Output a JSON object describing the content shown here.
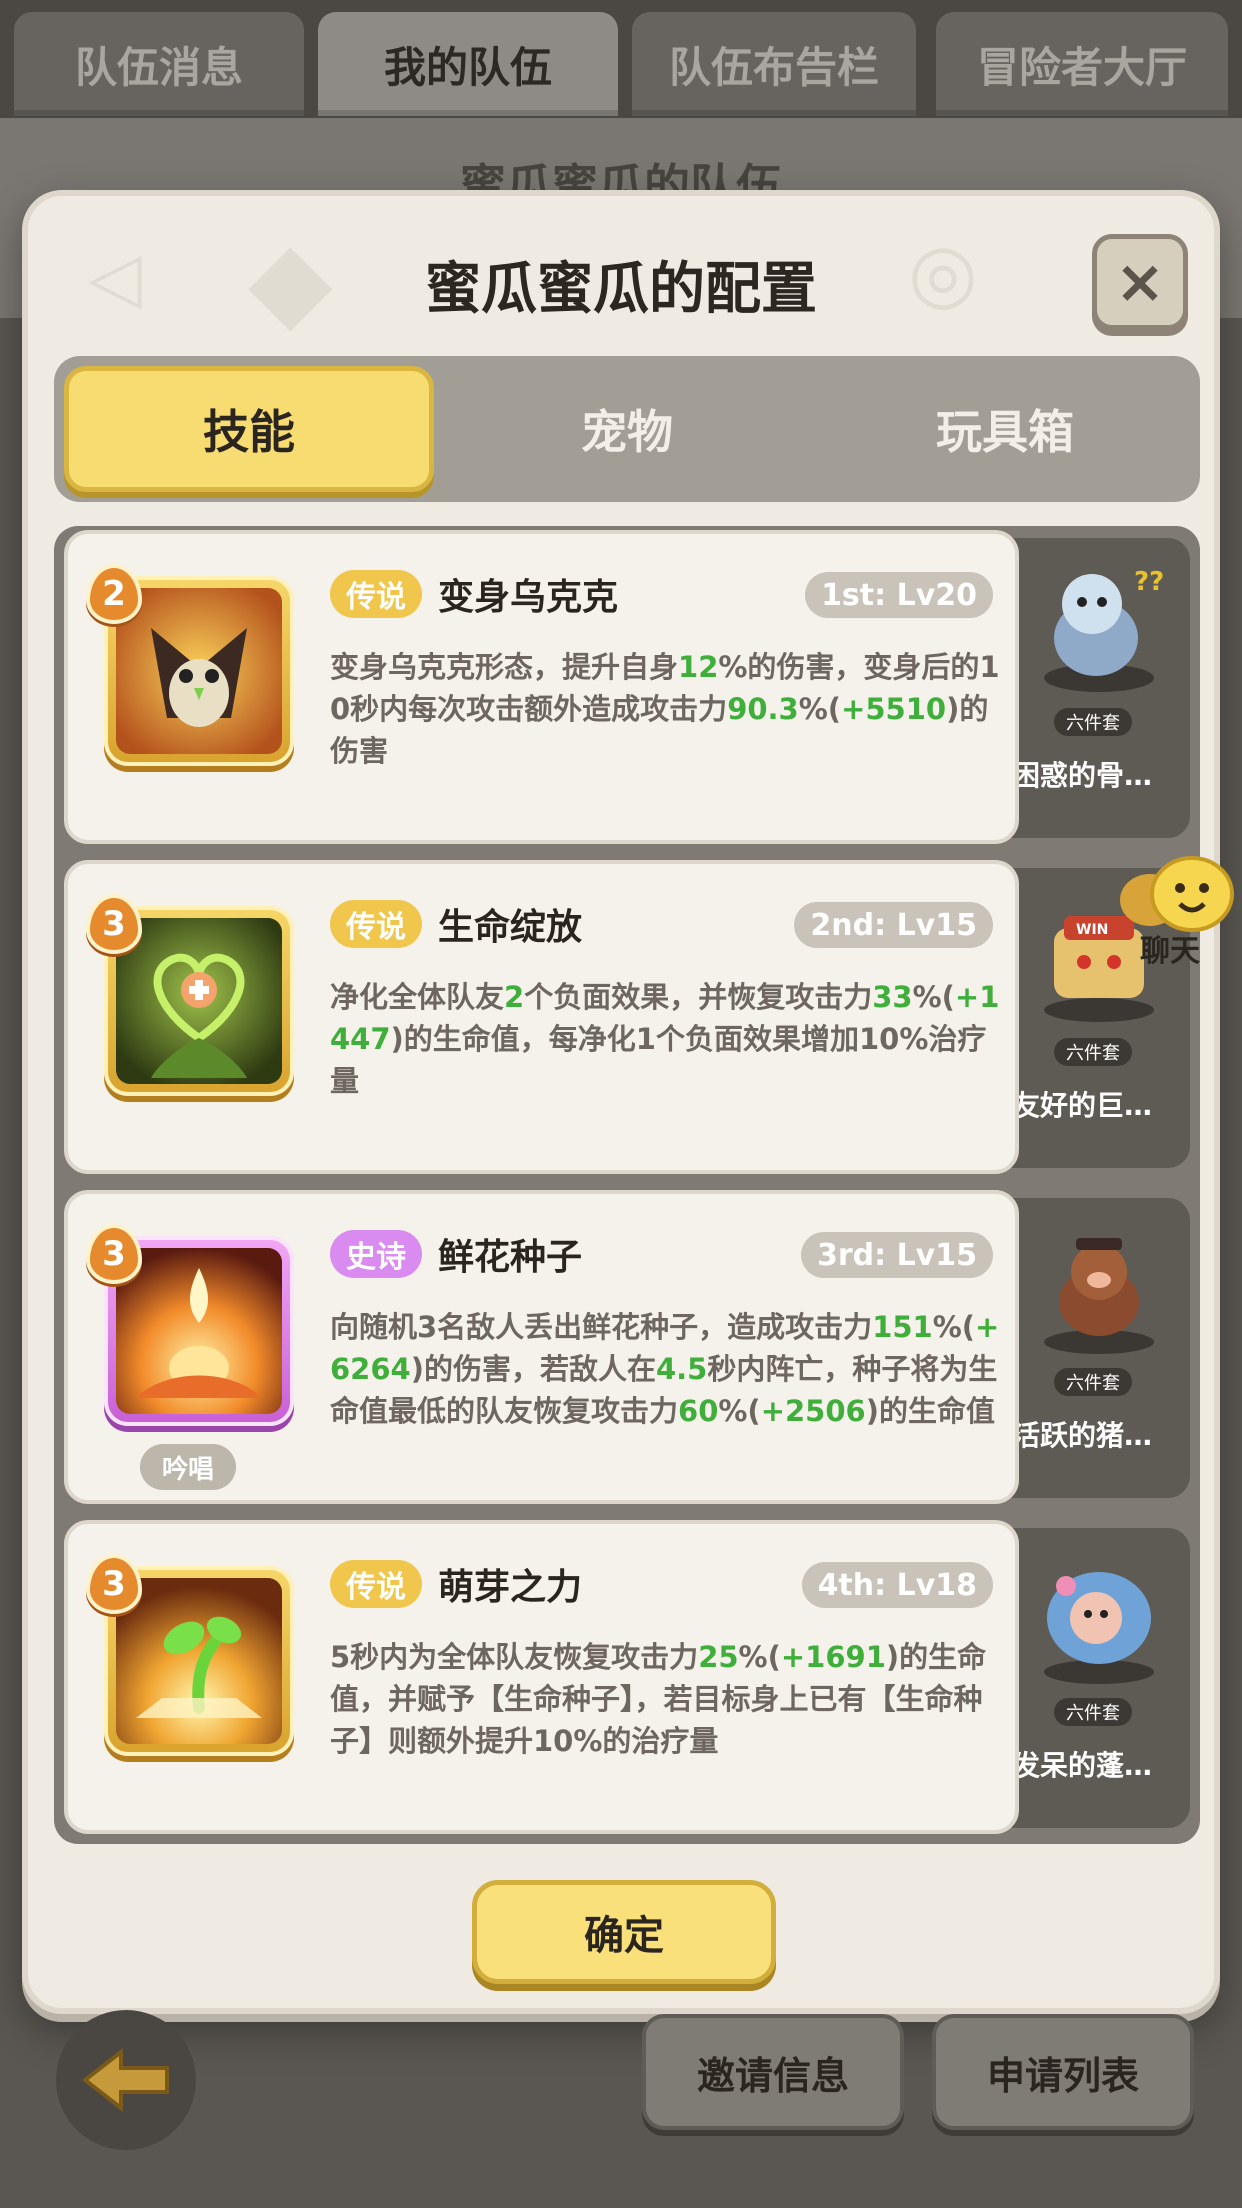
{
  "top_tabs": [
    "队伍消息",
    "我的队伍",
    "队伍布告栏",
    "冒险者大厅"
  ],
  "background_title": "蜜瓜蜜瓜的队伍",
  "modal": {
    "title": "蜜瓜蜜瓜的配置",
    "close_label": "×",
    "tabs": [
      "技能",
      "宠物",
      "玩具箱"
    ],
    "confirm_label": "确定"
  },
  "skills": [
    {
      "level": "2",
      "rarity": "传说",
      "name": "变身乌克克",
      "slot": "1st: Lv20",
      "desc_parts": [
        {
          "t": "变身乌克克形态，提升自身"
        },
        {
          "t": "12",
          "hl": true
        },
        {
          "t": "%的伤害，变身后的10秒内每次攻击额外造成攻击力"
        },
        {
          "t": "90.3",
          "hl": true
        },
        {
          "t": "%("
        },
        {
          "t": "+5510",
          "hl": true
        },
        {
          "t": ")的伤害"
        }
      ],
      "pet_name": "困惑的骨…",
      "pet_tag": "六件套"
    },
    {
      "level": "3",
      "rarity": "传说",
      "name": "生命绽放",
      "slot": "2nd: Lv15",
      "desc_parts": [
        {
          "t": "净化全体队友"
        },
        {
          "t": "2",
          "hl": true
        },
        {
          "t": "个负面效果，并恢复攻击力"
        },
        {
          "t": "33",
          "hl": true
        },
        {
          "t": "%("
        },
        {
          "t": "+1447",
          "hl": true
        },
        {
          "t": ")的生命值，每净化1个负面效果增加10%治疗量"
        }
      ],
      "pet_name": "友好的巨…",
      "pet_tag": "六件套"
    },
    {
      "level": "3",
      "rarity": "史诗",
      "name": "鲜花种子",
      "slot": "3rd: Lv15",
      "chant": "吟唱",
      "desc_parts": [
        {
          "t": "向随机3名敌人丢出鲜花种子，造成攻击力"
        },
        {
          "t": "151",
          "hl": true
        },
        {
          "t": "%("
        },
        {
          "t": "+6264",
          "hl": true
        },
        {
          "t": ")的伤害，若敌人在"
        },
        {
          "t": "4.5",
          "hl": true
        },
        {
          "t": "秒内阵亡，种子将为生命值最低的队友恢复攻击力"
        },
        {
          "t": "60",
          "hl": true
        },
        {
          "t": "%("
        },
        {
          "t": "+2506",
          "hl": true
        },
        {
          "t": ")的生命值"
        }
      ],
      "pet_name": "活跃的猪…",
      "pet_tag": "六件套"
    },
    {
      "level": "3",
      "rarity": "传说",
      "name": "萌芽之力",
      "slot": "4th: Lv18",
      "desc_parts": [
        {
          "t": "5秒内为全体队友恢复攻击力"
        },
        {
          "t": "25",
          "hl": true
        },
        {
          "t": "%("
        },
        {
          "t": "+1691",
          "hl": true
        },
        {
          "t": ")的生命值，并赋予【生命种子】，若目标身上已有【生命种子】则额外提升10%的治疗量"
        }
      ],
      "pet_name": "发呆的蓬…",
      "pet_tag": "六件套"
    }
  ],
  "chat_label": "聊天",
  "bottom_buttons": [
    "邀请信息",
    "申请列表"
  ],
  "colors": {
    "accent_yellow": "#f7dc72",
    "legend": "#f1c64c",
    "epic": "#d98bf0",
    "highlight_green": "#3fae3a"
  }
}
